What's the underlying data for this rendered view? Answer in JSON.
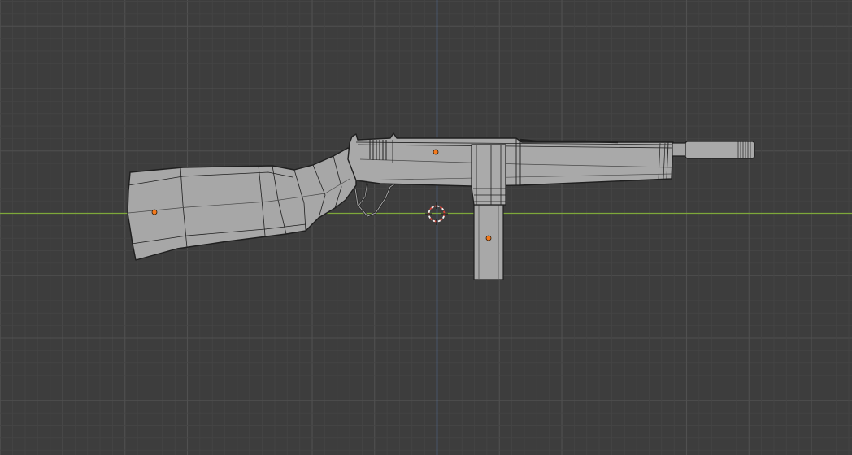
{
  "viewport": {
    "background": "#3d3d3d",
    "grid_minor_color": "#454545",
    "grid_major_color": "#505050",
    "x_axis_color": "#7ea83a",
    "z_axis_color": "#5b86c4",
    "mesh_fill": "#a9a9a9",
    "mesh_wire": "#1f1f1f",
    "origin_color": "#f47a1d",
    "cursor_color": "#d8473c"
  },
  "scene": {
    "objects": [
      {
        "name": "stock",
        "icon": "object-origin-icon"
      },
      {
        "name": "receiver",
        "icon": "object-origin-icon"
      },
      {
        "name": "magazine",
        "icon": "object-origin-icon"
      }
    ],
    "cursor_icon": "3d-cursor-icon"
  }
}
